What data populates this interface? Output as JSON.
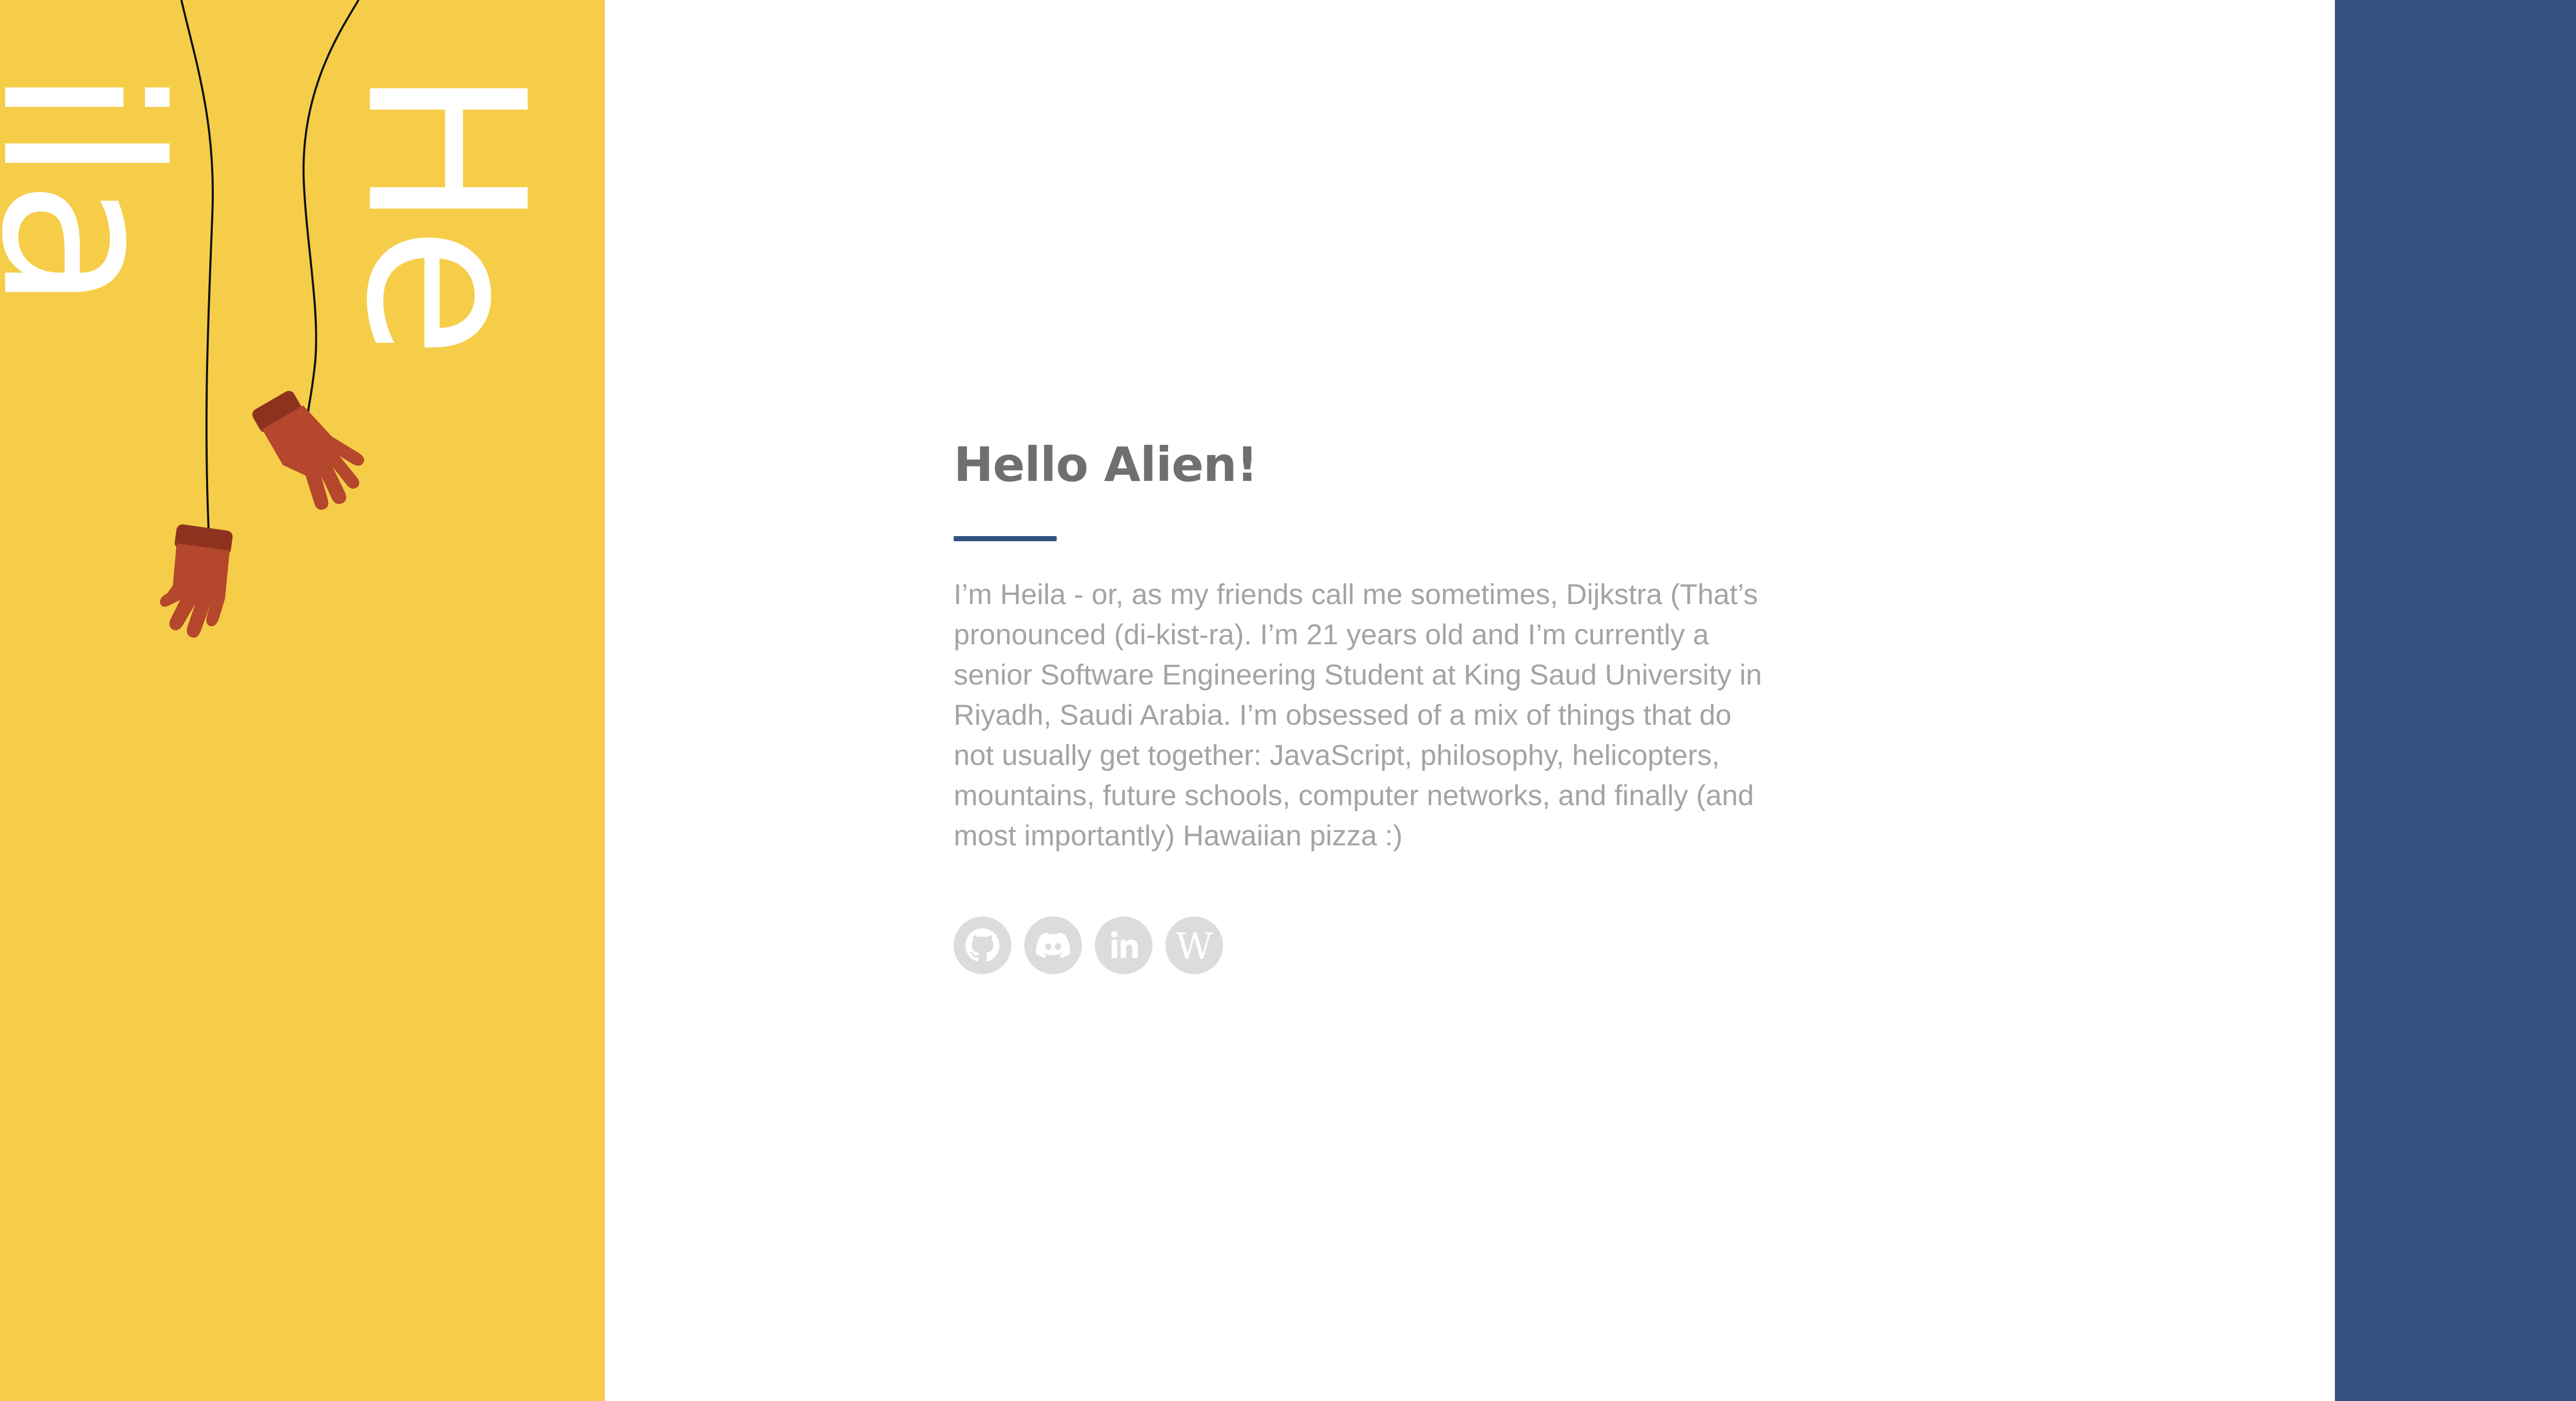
{
  "colors": {
    "yellow": "#f5cd48",
    "navy": "#34527f",
    "accent_rule": "#34527f",
    "heading": "#6f6f6f",
    "body_text": "#a3a3a8",
    "icon_bg": "#dcdcdc",
    "white": "#ffffff",
    "glove": "#b4472c",
    "glove_cuff": "#8e3220"
  },
  "hero_name": {
    "line1": "He",
    "line2": "ila"
  },
  "about": {
    "heading": "Hello Alien!",
    "bio": "I’m Heila - or, as my friends call me sometimes, Dijkstra (That’s pronounced (di-kist-ra). I’m 21 years old and I’m currently a senior Software Engineering Student at King Saud University in Riyadh, Saudi Arabia. I’m obsessed of a mix of things that do not usually get together: JavaScript, philosophy, helicopters, mountains, future schools, computer networks, and finally (and most importantly) Hawaiian pizza :)"
  },
  "socials": [
    {
      "icon": "github-icon"
    },
    {
      "icon": "discord-icon"
    },
    {
      "icon": "linkedin-icon"
    },
    {
      "icon": "wikipedia-icon",
      "glyph": "W"
    }
  ]
}
